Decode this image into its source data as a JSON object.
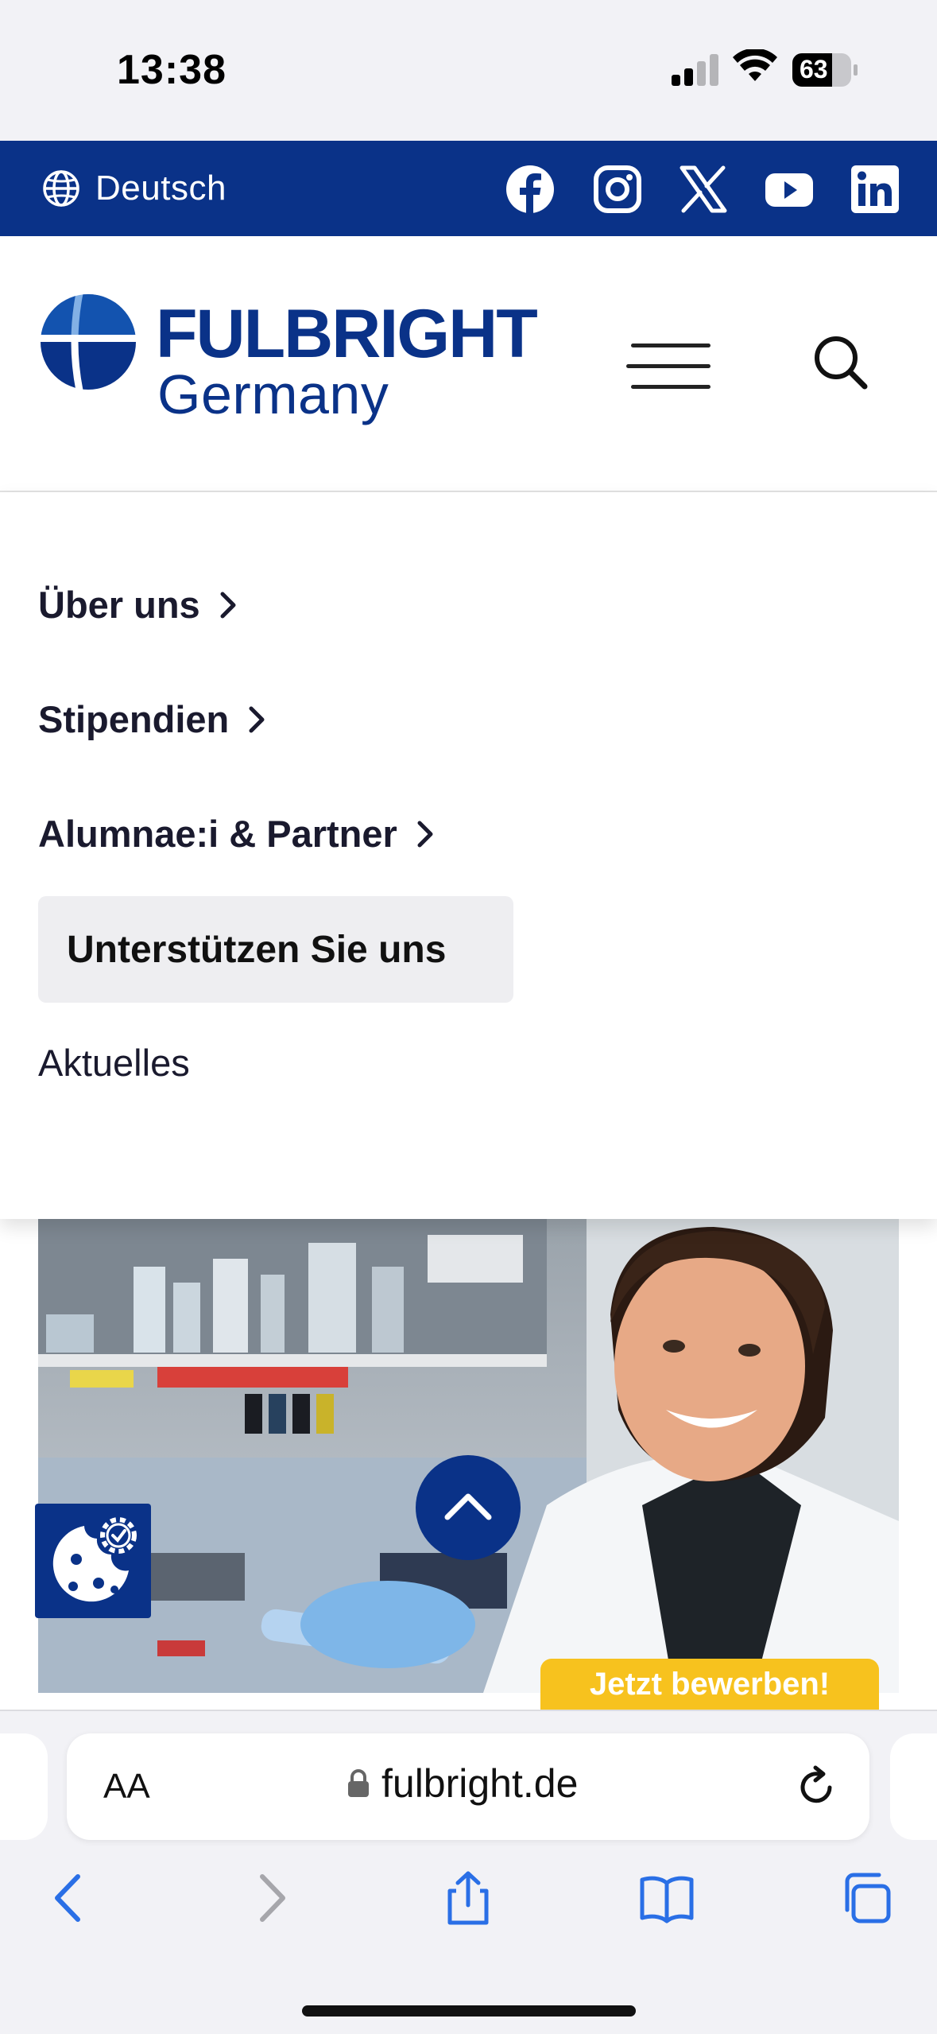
{
  "status_bar": {
    "time": "13:38",
    "battery": "63"
  },
  "util_bar": {
    "language": "Deutsch",
    "social": [
      "facebook-icon",
      "instagram-icon",
      "x-icon",
      "youtube-icon",
      "linkedin-icon"
    ]
  },
  "header": {
    "logo_line1": "FULBRIGHT",
    "logo_line2": "Germany"
  },
  "menu": {
    "items": [
      {
        "label": "Über uns",
        "has_submenu": true
      },
      {
        "label": "Stipendien",
        "has_submenu": true
      },
      {
        "label": "Alumnae:i & Partner",
        "has_submenu": true
      }
    ],
    "highlight_button": "Unterstützen Sie uns",
    "plain_item": "Aktuelles"
  },
  "content": {
    "apply_badge": "Jetzt bewerben!"
  },
  "browser": {
    "text_size": "AA",
    "url": "fulbright.de"
  },
  "colors": {
    "brand": "#0a3288",
    "accent": "#f7c21e"
  }
}
